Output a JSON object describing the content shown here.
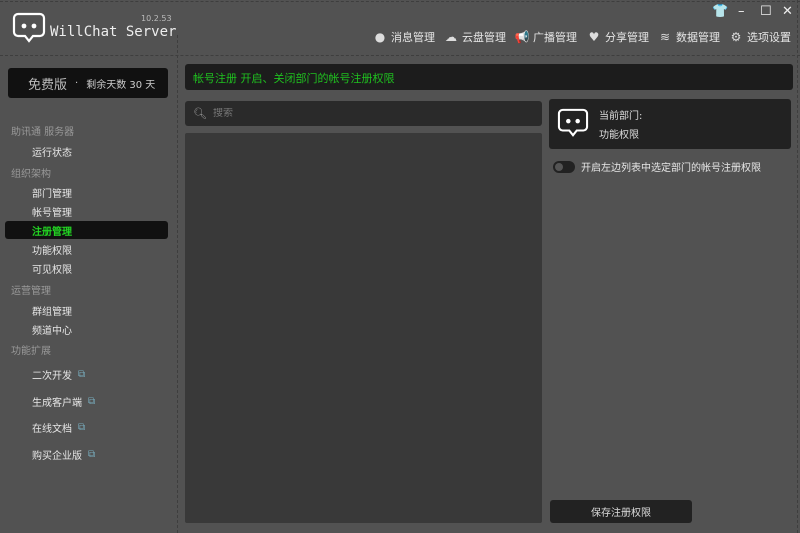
{
  "app": {
    "title": "WillChat Server",
    "version": "10.2.53"
  },
  "nav": [
    {
      "label": "消息管理",
      "icon": "chat-bubble-icon"
    },
    {
      "label": "云盘管理",
      "icon": "cloud-icon"
    },
    {
      "label": "广播管理",
      "icon": "megaphone-icon"
    },
    {
      "label": "分享管理",
      "icon": "heart-icon"
    },
    {
      "label": "数据管理",
      "icon": "database-icon"
    },
    {
      "label": "选项设置",
      "icon": "gear-icon"
    }
  ],
  "license": {
    "edition": "免费版",
    "remaining": "剩余天数 30 天"
  },
  "sidebar": {
    "sections": [
      {
        "title": "助讯通 服务器",
        "items": [
          "运行状态"
        ]
      },
      {
        "title": "组织架构",
        "items": [
          "部门管理",
          "帐号管理",
          "注册管理",
          "功能权限",
          "可见权限"
        ]
      },
      {
        "title": "运营管理",
        "items": [
          "群组管理",
          "频道中心"
        ]
      },
      {
        "title": "功能扩展",
        "items": [
          "二次开发",
          "生成客户端",
          "在线文档",
          "购买企业版"
        ]
      }
    ],
    "selected": "注册管理"
  },
  "banner": "帐号注册 开启、关闭部门的帐号注册权限",
  "search": {
    "placeholder": "搜索",
    "value": ""
  },
  "card": {
    "title": "当前部门:",
    "department": "功能权限"
  },
  "toggle": {
    "label": "开启左边列表中选定部门的帐号注册权限",
    "on": false
  },
  "save_label": "保存注册权限",
  "colors": {
    "accent": "#1fc11f",
    "background": "#525252"
  }
}
